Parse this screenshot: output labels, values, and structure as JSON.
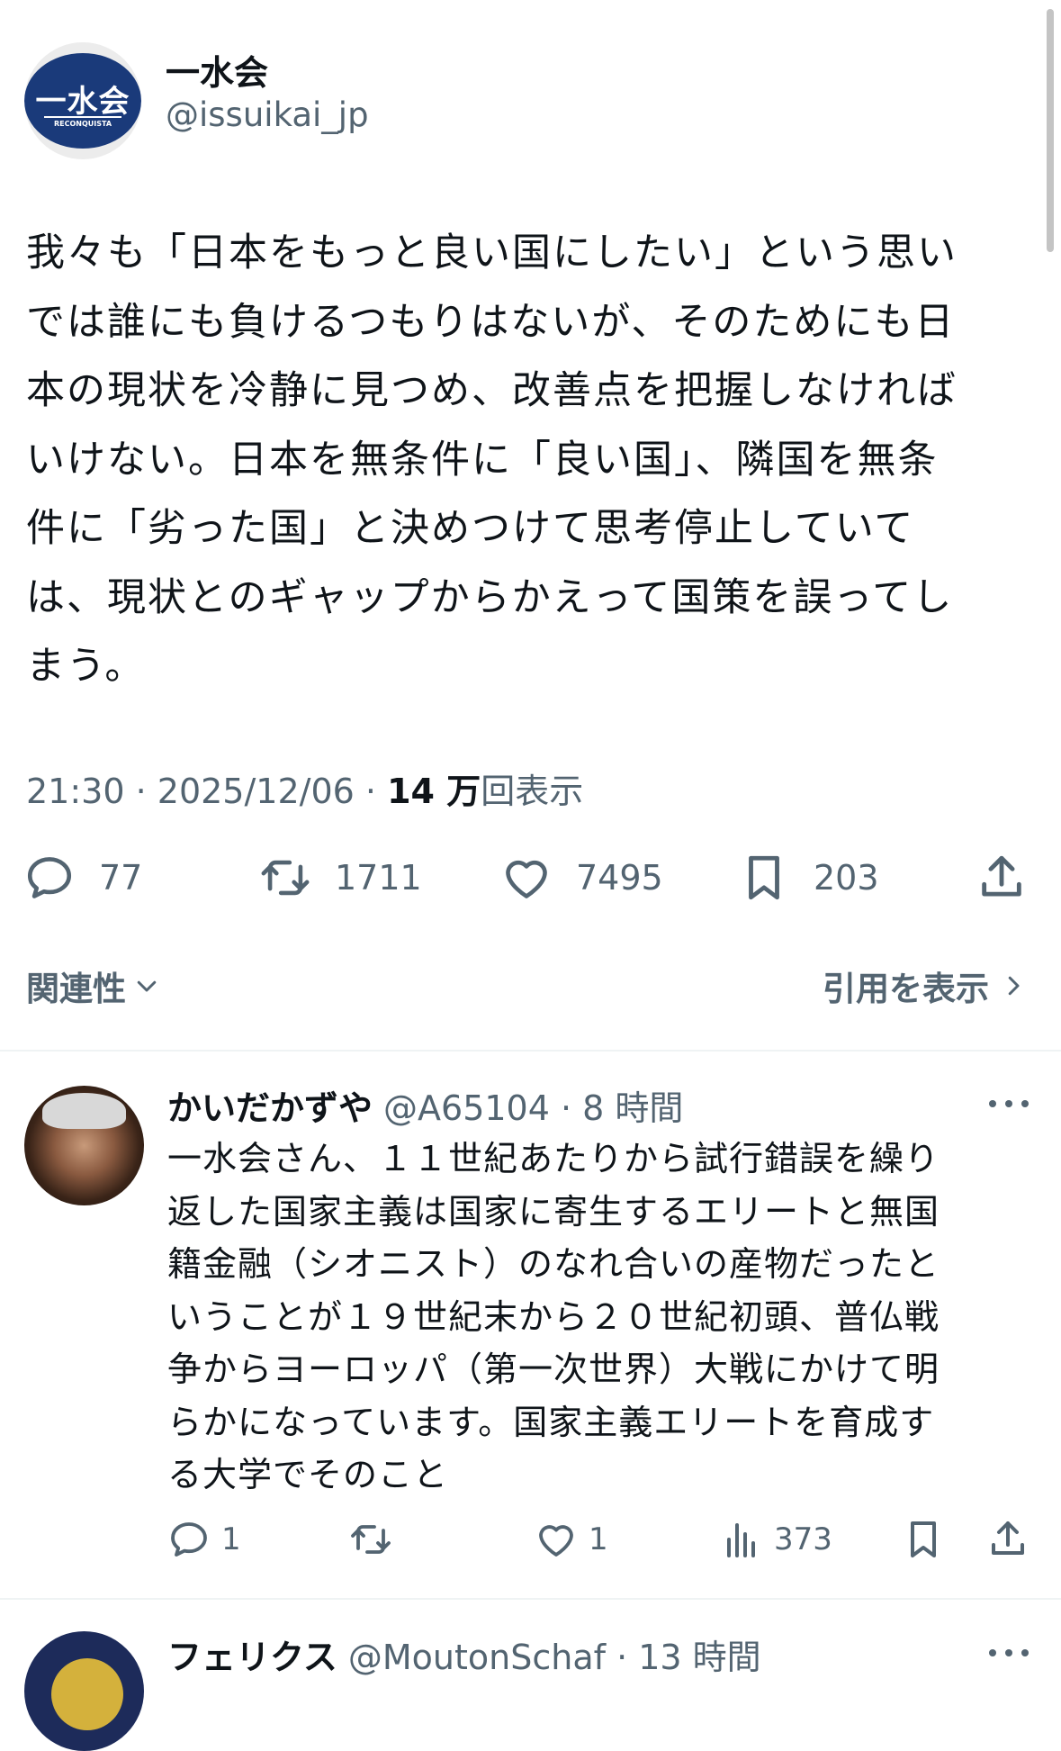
{
  "main_tweet": {
    "author": {
      "display_name": "一水会",
      "handle": "@issuikai_jp",
      "avatar_text": "一水会",
      "avatar_subtext": "RECONQUISTA"
    },
    "text": "我々も「日本をもっと良い国にしたい」という思い\nでは誰にも負けるつもりはないが、そのためにも日\n本の現状を冷静に見つめ、改善点を把握しなければ\nいけない。日本を無条件に「良い国」、隣国を無条\n件に「劣った国」と決めつけて思考停止していて\nは、現状とのギャップからかえって国策を誤ってし\nまう。",
    "time": "21:30",
    "date": "2025/12/06",
    "views_count": "14 万",
    "views_label": "回表示",
    "stats": {
      "replies": "77",
      "reposts": "1711",
      "likes": "7495",
      "bookmarks": "203"
    }
  },
  "sort_label": "関連性",
  "quotes_label": "引用を表示",
  "replies": [
    {
      "display_name": "かいだかずや",
      "handle": "@A65104",
      "time_ago": "8 時間",
      "text": "一水会さん、１１世紀あたりから試行錯誤を繰り\n返した国家主義は国家に寄生するエリートと無国\n籍金融（シオニスト）のなれ合いの産物だったと\nいうことが１９世紀末から２０世紀初頭、普仏戦\n争からヨーロッパ（第一次世界）大戦にかけて明\nらかになっています。国家主義エリートを育成す\nる大学でそのこと",
      "stats": {
        "replies": "1",
        "likes": "1",
        "views": "373"
      }
    },
    {
      "display_name": "フェリクス",
      "handle": "@MoutonSchaf",
      "time_ago": "13 時間"
    }
  ],
  "icons": {
    "reply": "reply-icon",
    "repost": "repost-icon",
    "like": "heart-icon",
    "bookmark": "bookmark-icon",
    "share": "share-icon",
    "views": "analytics-icon",
    "more": "more-icon",
    "chevron_down": "chevron-down-icon",
    "chevron_right": "chevron-right-icon"
  },
  "colors": {
    "text": "#0f1419",
    "secondary": "#536471",
    "divider": "#eff3f4",
    "avatar_brand": "#1a3a7a"
  }
}
